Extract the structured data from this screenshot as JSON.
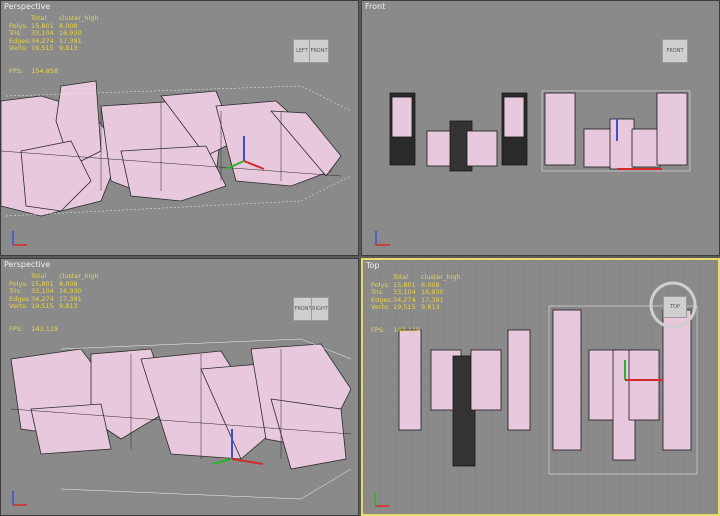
{
  "viewports": [
    {
      "label": "Perspective",
      "stats": {
        "header": [
          "",
          "Total",
          "cluster_high"
        ],
        "rows": [
          [
            "Polys:",
            "15,801",
            "8,008"
          ],
          [
            "Tris:",
            "33,104",
            "16,930"
          ],
          [
            "Edges:",
            "34,274",
            "17,391"
          ],
          [
            "Verts:",
            "19,515",
            "9,813"
          ]
        ]
      },
      "fps_label": "FPS:",
      "fps_value": "154.858",
      "cube_faces": [
        "LEFT",
        "FRONT"
      ]
    },
    {
      "label": "Front",
      "cube_faces": [
        "FRONT"
      ]
    },
    {
      "label": "Perspective",
      "stats": {
        "header": [
          "",
          "Total",
          "cluster_high"
        ],
        "rows": [
          [
            "Polys:",
            "15,801",
            "8,008"
          ],
          [
            "Tris:",
            "33,104",
            "16,930"
          ],
          [
            "Edges:",
            "34,274",
            "17,391"
          ],
          [
            "Verts:",
            "19,515",
            "9,813"
          ]
        ]
      },
      "fps_label": "FPS:",
      "fps_value": "143.119",
      "cube_faces": [
        "FRONT",
        "RIGHT"
      ]
    },
    {
      "label": "Top",
      "stats": {
        "header": [
          "",
          "Total",
          "cluster_high"
        ],
        "rows": [
          [
            "Polys:",
            "15,801",
            "8,008"
          ],
          [
            "Tris:",
            "33,104",
            "16,930"
          ],
          [
            "Edges:",
            "34,274",
            "17,391"
          ],
          [
            "Verts:",
            "19,515",
            "9,813"
          ]
        ]
      },
      "fps_label": "FPS:",
      "fps_value": "143.119",
      "cube_faces": [
        "TOP"
      ]
    }
  ],
  "colors": {
    "model": "#e8c8dc",
    "edge": "#2a2a2a",
    "stats": "#e8d44a",
    "active_border": "#e6dc6e",
    "background": "#8a8a8a"
  }
}
